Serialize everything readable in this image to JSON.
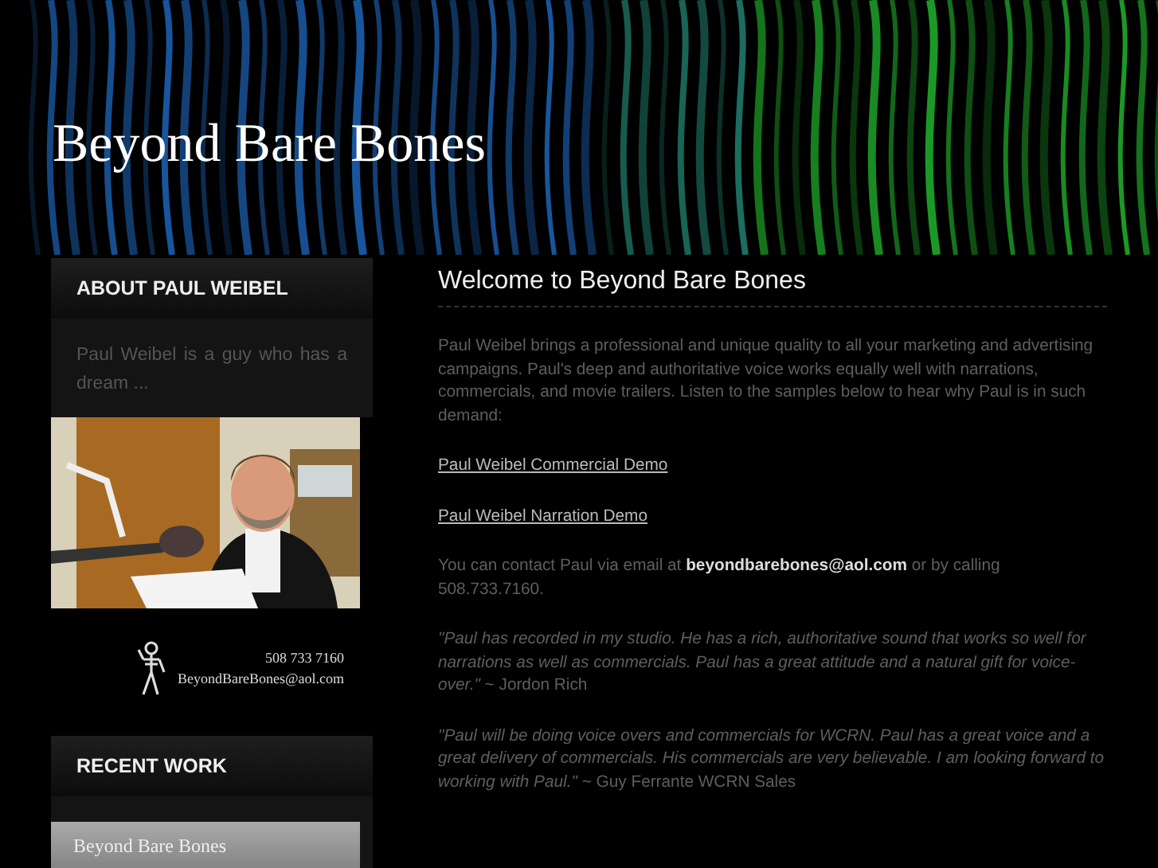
{
  "header": {
    "title": "Beyond Bare Bones"
  },
  "sidebar": {
    "about": {
      "heading": "ABOUT PAUL WEIBEL",
      "text": "Paul Weibel is a guy who has a dream ...",
      "contact_card": {
        "phone": "508 733 7160",
        "email": "BeyondBareBones@aol.com"
      }
    },
    "recent_work": {
      "heading": "RECENT WORK",
      "thumbnail": {
        "title": "Beyond Bare Bones"
      }
    }
  },
  "main": {
    "heading": "Welcome to Beyond Bare Bones",
    "paragraphs": [
      {
        "kind": "text",
        "text": "Paul Weibel brings a professional and unique quality to all your marketing and advertising campaigns. Paul's deep and authoritative voice works equally well with narrations, commercials, and movie trailers. Listen to the samples below to hear why Paul is in such demand:"
      },
      {
        "kind": "link",
        "text": "Paul Weibel Commercial Demo"
      },
      {
        "kind": "link",
        "text": "Paul Weibel Narration Demo"
      },
      {
        "kind": "text",
        "text": "You can contact Paul via email at **beyondbarebones@aol.com** or by calling 508.733.7160."
      },
      {
        "kind": "quote",
        "text": "*\"Paul has recorded in my studio. He has a rich, authoritative sound that works so well for narrations as well as commercials. Paul has a great attitude and a natural gift for voice-over.\"* ~ Jordon Rich"
      },
      {
        "kind": "quote",
        "text": "*\"Paul will be doing voice overs and commercials for WCRN. Paul has a great voice and a great delivery of commercials. His commercials are very believable. I am looking forward to working with Paul.\"* ~ Guy Ferrante WCRN Sales"
      }
    ]
  }
}
